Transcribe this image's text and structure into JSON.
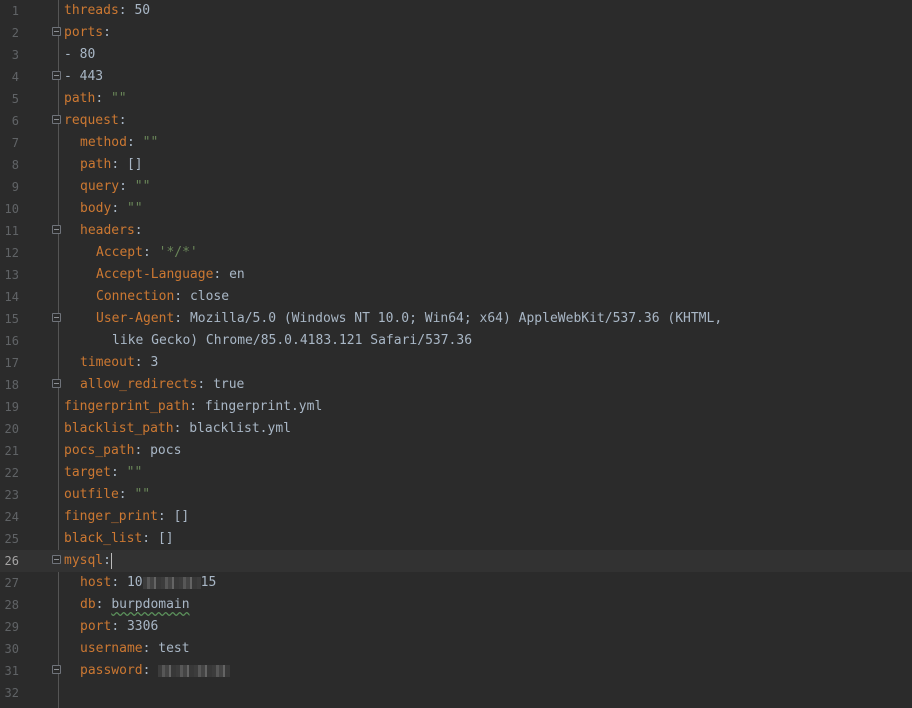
{
  "editor": {
    "current_line": 26,
    "lines": [
      {
        "n": "1",
        "key": "threads",
        "sep": ": ",
        "value": "50",
        "vtype": "v",
        "indent": 0
      },
      {
        "n": "2",
        "key": "ports",
        "sep": ":",
        "value": "",
        "vtype": "v",
        "indent": 0,
        "fold": true
      },
      {
        "n": "3",
        "key": "",
        "sep": "- ",
        "value": "80",
        "vtype": "v",
        "indent": 0
      },
      {
        "n": "4",
        "key": "",
        "sep": "- ",
        "value": "443",
        "vtype": "v",
        "indent": 0,
        "fold": true
      },
      {
        "n": "5",
        "key": "path",
        "sep": ": ",
        "value": "\"\"",
        "vtype": "s",
        "indent": 0
      },
      {
        "n": "6",
        "key": "request",
        "sep": ":",
        "value": "",
        "vtype": "v",
        "indent": 0,
        "fold": true
      },
      {
        "n": "7",
        "key": "method",
        "sep": ": ",
        "value": "\"\"",
        "vtype": "s",
        "indent": 1
      },
      {
        "n": "8",
        "key": "path",
        "sep": ": ",
        "value": "[]",
        "vtype": "v",
        "indent": 1
      },
      {
        "n": "9",
        "key": "query",
        "sep": ": ",
        "value": "\"\"",
        "vtype": "s",
        "indent": 1
      },
      {
        "n": "10",
        "key": "body",
        "sep": ": ",
        "value": "\"\"",
        "vtype": "s",
        "indent": 1
      },
      {
        "n": "11",
        "key": "headers",
        "sep": ":",
        "value": "",
        "vtype": "v",
        "indent": 1,
        "fold": true
      },
      {
        "n": "12",
        "key": "Accept",
        "sep": ": ",
        "value": "'*/*'",
        "vtype": "s",
        "indent": 2
      },
      {
        "n": "13",
        "key": "Accept-Language",
        "sep": ": ",
        "value": "en",
        "vtype": "v",
        "indent": 2
      },
      {
        "n": "14",
        "key": "Connection",
        "sep": ": ",
        "value": "close",
        "vtype": "v",
        "indent": 2
      },
      {
        "n": "15",
        "key": "User-Agent",
        "sep": ": ",
        "value": "Mozilla/5.0 (Windows NT 10.0; Win64; x64) AppleWebKit/537.36 (KHTML,",
        "vtype": "v",
        "indent": 2,
        "fold": true
      },
      {
        "n": "16",
        "key": "",
        "sep": "",
        "value": "like Gecko) Chrome/85.0.4183.121 Safari/537.36",
        "vtype": "v",
        "indent": 3
      },
      {
        "n": "17",
        "key": "timeout",
        "sep": ": ",
        "value": "3",
        "vtype": "v",
        "indent": 1
      },
      {
        "n": "18",
        "key": "allow_redirects",
        "sep": ": ",
        "value": "true",
        "vtype": "v",
        "indent": 1,
        "fold": true
      },
      {
        "n": "19",
        "key": "fingerprint_path",
        "sep": ": ",
        "value": "fingerprint.yml",
        "vtype": "v",
        "indent": 0
      },
      {
        "n": "20",
        "key": "blacklist_path",
        "sep": ": ",
        "value": "blacklist.yml",
        "vtype": "v",
        "indent": 0
      },
      {
        "n": "21",
        "key": "pocs_path",
        "sep": ": ",
        "value": "pocs",
        "vtype": "v",
        "indent": 0
      },
      {
        "n": "22",
        "key": "target",
        "sep": ": ",
        "value": "\"\"",
        "vtype": "s",
        "indent": 0
      },
      {
        "n": "23",
        "key": "outfile",
        "sep": ": ",
        "value": "\"\"",
        "vtype": "s",
        "indent": 0
      },
      {
        "n": "24",
        "key": "finger_print",
        "sep": ": ",
        "value": "[]",
        "vtype": "v",
        "indent": 0
      },
      {
        "n": "25",
        "key": "black_list",
        "sep": ": ",
        "value": "[]",
        "vtype": "v",
        "indent": 0
      },
      {
        "n": "26",
        "key": "mysql",
        "sep": ":",
        "value": "",
        "vtype": "v",
        "indent": 0,
        "fold": true,
        "caret": true
      },
      {
        "n": "27",
        "key": "host",
        "sep": ": ",
        "value": "10",
        "value_tail": "15",
        "redacted": true,
        "vtype": "v",
        "indent": 1
      },
      {
        "n": "28",
        "key": "db",
        "sep": ": ",
        "value": "burpdomain",
        "vtype": "v",
        "indent": 1,
        "spell": true
      },
      {
        "n": "29",
        "key": "port",
        "sep": ": ",
        "value": "3306",
        "vtype": "v",
        "indent": 1
      },
      {
        "n": "30",
        "key": "username",
        "sep": ": ",
        "value": "test",
        "vtype": "v",
        "indent": 1
      },
      {
        "n": "31",
        "key": "password",
        "sep": ": ",
        "value": "",
        "redacted_only": true,
        "vtype": "v",
        "indent": 1,
        "fold": true
      },
      {
        "n": "32",
        "key": "",
        "sep": "",
        "value": "",
        "vtype": "v",
        "indent": 0
      }
    ]
  },
  "colors": {
    "background": "#2b2b2b",
    "key": "#cc7832",
    "string": "#6a8759",
    "plain": "#a9b7c6",
    "line_number": "#606366",
    "current_line_bg": "#323232"
  }
}
